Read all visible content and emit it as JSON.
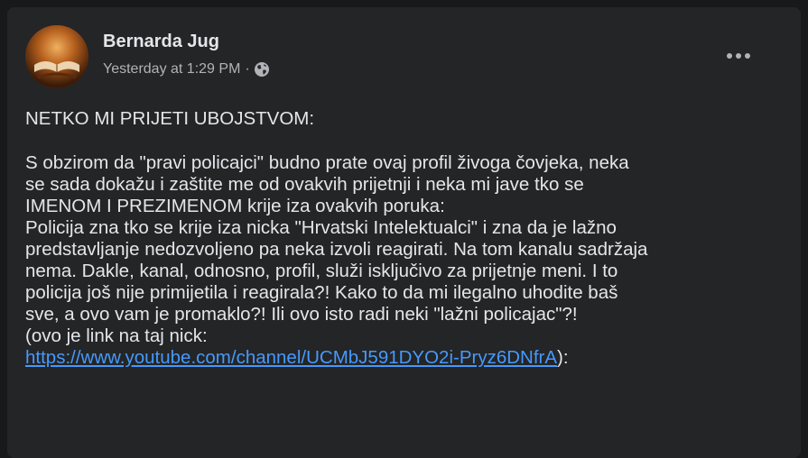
{
  "post": {
    "author": "Bernarda Jug",
    "timestamp": "Yesterday at 1:29 PM",
    "separator": "·",
    "audience_icon": "globe-icon",
    "menu_icon": "more-horizontal-icon",
    "body": {
      "heading": "NETKO MI PRIJETI UBOJSTVOM:",
      "paragraph": "S obzirom da \"pravi policajci\" budno prate ovaj profil živoga čovjeka, neka\nse sada dokažu i zaštite me od ovakvih prijetnji i neka mi jave tko se\nIMENOM I PREZIMENOM krije iza ovakvih poruka:\nPolicija zna tko se krije iza nicka \"Hrvatski Intelektualci\" i zna da je lažno\npredstavljanje nedozvoljeno pa neka izvoli reagirati. Na tom kanalu sadržaja\nnema. Dakle, kanal, odnosno, profil, služi isključivo za prijetnje meni. I to\npolicija još nije primijetila i reagirala?! Kako to da mi ilegalno uhodite baš\nsve, a ovo vam je promaklo?! Ili ovo isto radi neki \"lažni policajac\"?!\n(ovo je link na taj nick:",
      "link": "https://www.youtube.com/channel/UCMbJ591DYO2i-Pryz6DNfrA",
      "link_suffix": "):"
    }
  },
  "colors": {
    "page_background": "#18191a",
    "card_background": "#242526",
    "primary_text": "#e4e6eb",
    "secondary_text": "#b0b3b8",
    "link": "#4599ff"
  }
}
